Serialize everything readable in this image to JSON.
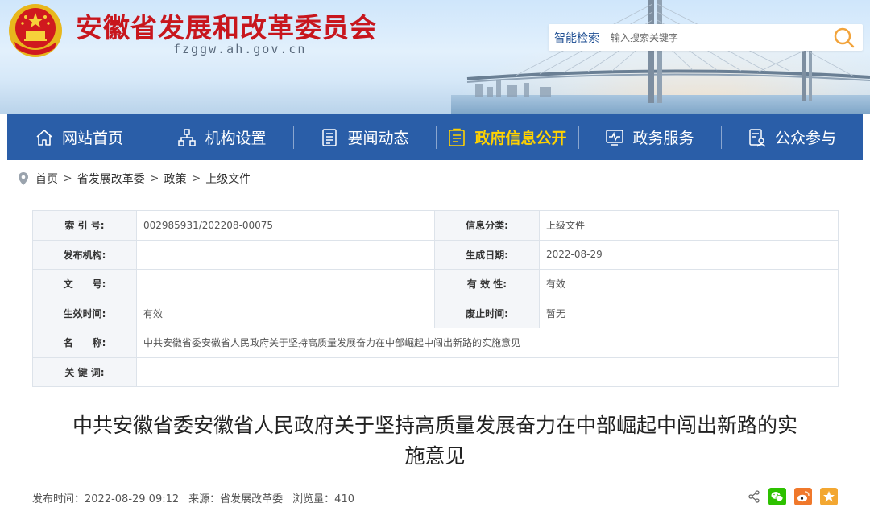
{
  "header": {
    "site_title": "安徽省发展和改革委员会",
    "site_domain": "fzggw.ah.gov.cn",
    "search": {
      "label": "智能检索",
      "placeholder": "输入搜索关键字"
    }
  },
  "nav": {
    "items": [
      {
        "label": "网站首页",
        "icon": "home-icon",
        "active": false
      },
      {
        "label": "机构设置",
        "icon": "org-chart-icon",
        "active": false
      },
      {
        "label": "要闻动态",
        "icon": "news-icon",
        "active": false
      },
      {
        "label": "政府信息公开",
        "icon": "info-disclosure-icon",
        "active": true
      },
      {
        "label": "政务服务",
        "icon": "service-monitor-icon",
        "active": false
      },
      {
        "label": "公众参与",
        "icon": "participation-icon",
        "active": false
      }
    ]
  },
  "breadcrumb": {
    "items": [
      "首页",
      "省发展改革委",
      "政策",
      "上级文件"
    ],
    "separator": ">"
  },
  "info": {
    "index_label": "索 引 号:",
    "index_value": "002985931/202208-00075",
    "category_label": "信息分类:",
    "category_value": "上级文件",
    "publisher_label": "发布机构:",
    "publisher_value": "",
    "created_label": "生成日期:",
    "created_value": "2022-08-29",
    "docno_label": "文　　号:",
    "docno_value": "",
    "validity_label": "有 效 性:",
    "validity_value": "有效",
    "effective_label": "生效时间:",
    "effective_value": "有效",
    "abolish_label": "废止时间:",
    "abolish_value": "暂无",
    "name_label": "名　　称:",
    "name_value": "中共安徽省委安徽省人民政府关于坚持高质量发展奋力在中部崛起中闯出新路的实施意见",
    "keywords_label": "关 键 词:",
    "keywords_value": ""
  },
  "article": {
    "title_line1": "中共安徽省委安徽省人民政府关于坚持高质量发展奋力在中部崛起中闯出新路的实",
    "title_line2": "施意见",
    "publish_time": "发布时间：2022-08-29 09:12",
    "source": "来源：省发展改革委",
    "views": "浏览量：410"
  },
  "colors": {
    "nav_bg": "#2a5ea8",
    "nav_active": "#ffd200",
    "title_red": "#c8161d",
    "search_accent": "#f2a33a"
  }
}
